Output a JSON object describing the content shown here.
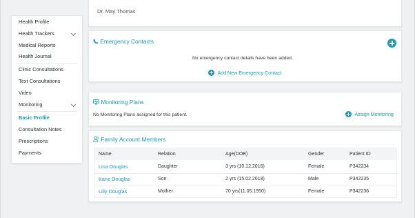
{
  "doctor": {
    "name": "Dr. May Thomas"
  },
  "sidebar": {
    "items": [
      {
        "label": "Health Profile"
      },
      {
        "label": "Health Trackers"
      },
      {
        "label": "Medical Reports"
      },
      {
        "label": "Health Journal"
      },
      {
        "label": "Clinic Consultations"
      },
      {
        "label": "Text Consultations"
      },
      {
        "label": "Video"
      },
      {
        "label": "Monitoring"
      },
      {
        "label": "Basic Profile"
      },
      {
        "label": "Consultation Notes"
      },
      {
        "label": "Prescriptions"
      },
      {
        "label": "Payments"
      }
    ]
  },
  "emergency": {
    "title": "Emergency Contacts",
    "empty_text": "No emergency contact details have been added.",
    "add_label": "Add New Emergency Contact"
  },
  "monitoring": {
    "title": "Monitoring Plans",
    "empty_text": "No Monitoring Plans assigned for this patient.",
    "assign_label": "Assign Monitoring"
  },
  "family": {
    "title": "Family Account Members",
    "headers": [
      "Name",
      "Relation",
      "Age(DOB)",
      "Gender",
      "Patient ID"
    ],
    "rows": [
      {
        "name": "Lina Douglas",
        "relation": "Daughter",
        "age": "3 yrs (10.12.2016)",
        "gender": "Female",
        "id": "P342234"
      },
      {
        "name": "Kane Douglas",
        "relation": "Son",
        "age": "2 yrs (15.02.2018)",
        "gender": "Male",
        "id": "P342235"
      },
      {
        "name": "Lilly Douglas",
        "relation": "Mother",
        "age": "70 yrs(11.05.1950)",
        "gender": "Female",
        "id": "P342236"
      }
    ]
  },
  "colors": {
    "accent": "#1a9bc1",
    "background": "#f0f1f3"
  }
}
